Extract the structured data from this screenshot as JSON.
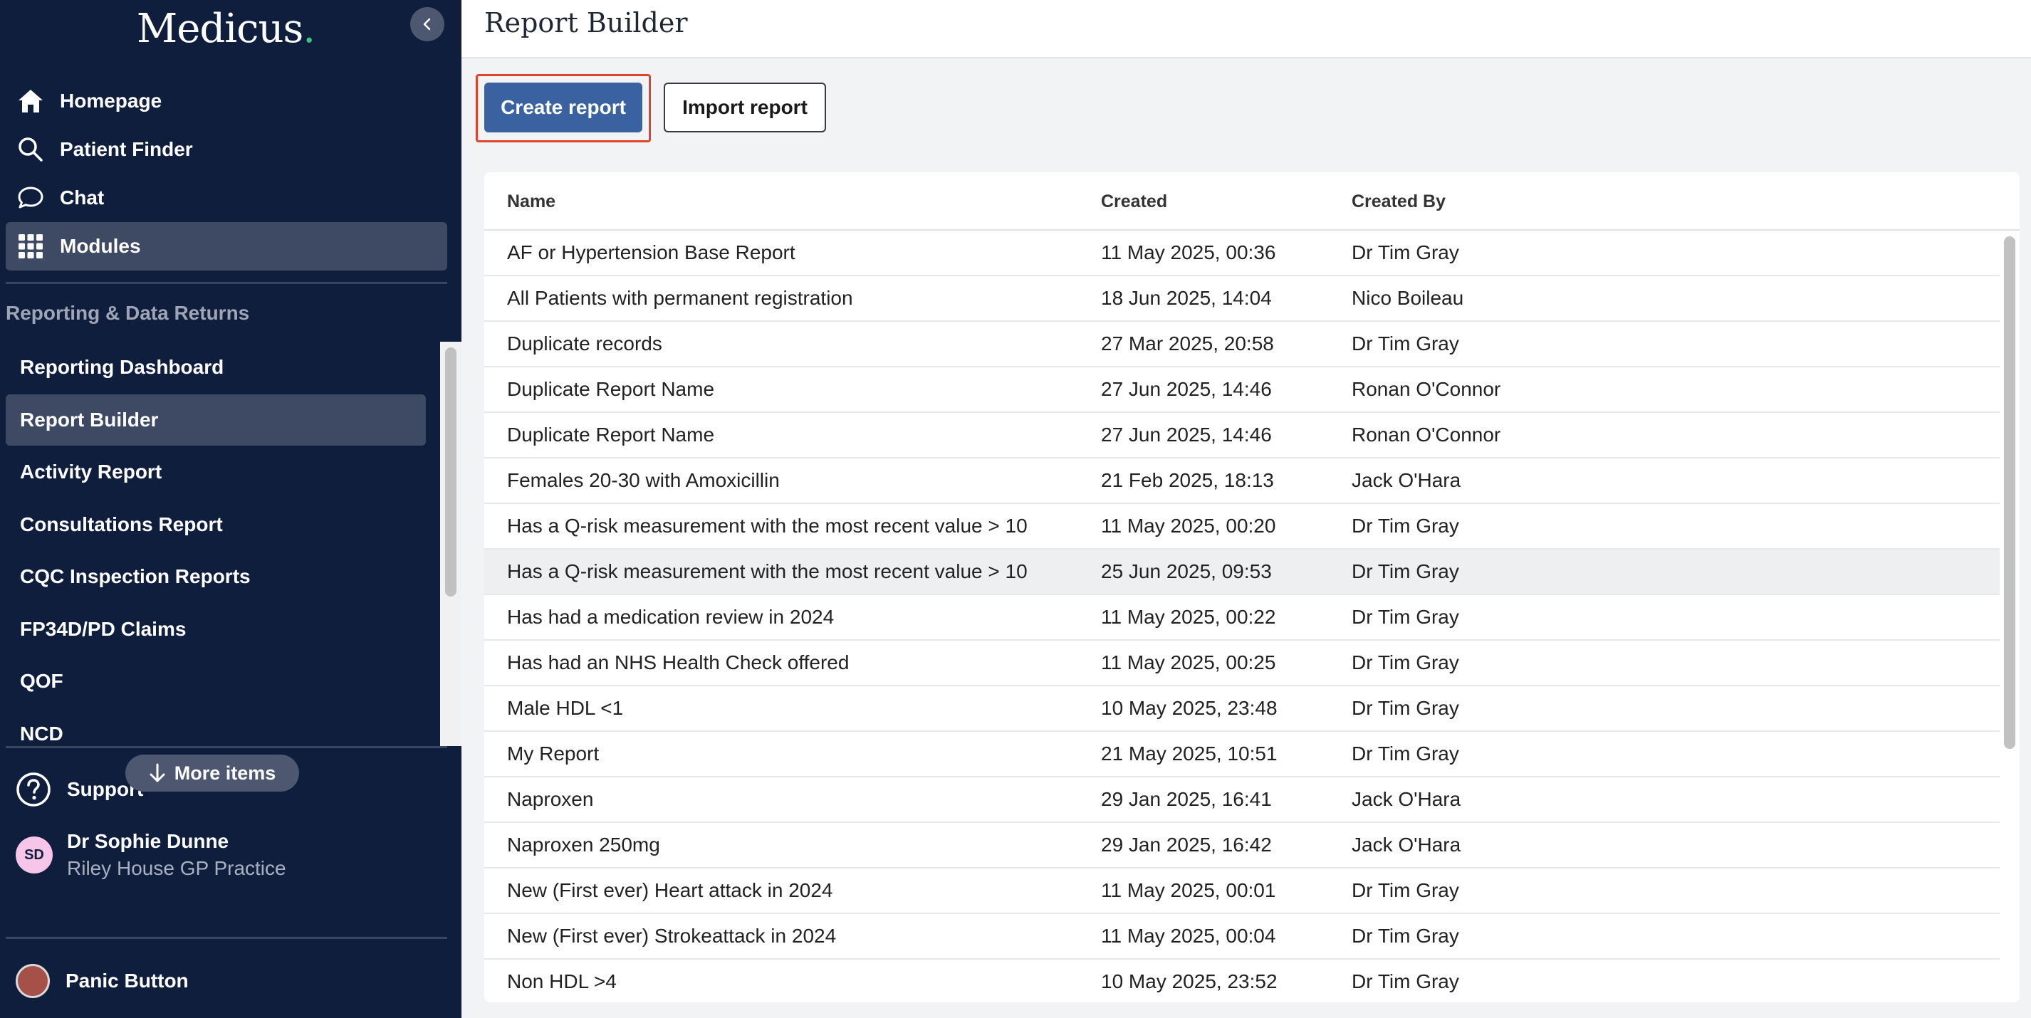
{
  "app": {
    "logo_text": "Medicus",
    "logo_dot": ".",
    "brand_color": "#0f1e3d",
    "accent_color": "#3b62a0"
  },
  "sidebar": {
    "nav": [
      {
        "label": "Homepage",
        "icon": "home-icon"
      },
      {
        "label": "Patient Finder",
        "icon": "search-icon"
      },
      {
        "label": "Chat",
        "icon": "chat-icon"
      },
      {
        "label": "Modules",
        "icon": "grid-icon",
        "active": true
      }
    ],
    "section_title": "Reporting & Data Returns",
    "sub_items": [
      {
        "label": "Reporting Dashboard"
      },
      {
        "label": "Report Builder",
        "active": true
      },
      {
        "label": "Activity Report"
      },
      {
        "label": "Consultations Report"
      },
      {
        "label": "CQC Inspection Reports"
      },
      {
        "label": "FP34D/PD Claims"
      },
      {
        "label": "QOF"
      },
      {
        "label": "NCD"
      }
    ],
    "more_items_label": "More items",
    "support_label": "Support",
    "user": {
      "initials": "SD",
      "name": "Dr Sophie Dunne",
      "practice": "Riley House GP Practice"
    },
    "panic_label": "Panic Button"
  },
  "header": {
    "title": "Report Builder"
  },
  "toolbar": {
    "create_label": "Create report",
    "import_label": "Import report"
  },
  "table": {
    "columns": [
      "Name",
      "Created",
      "Created By"
    ],
    "rows": [
      {
        "name": "AF or Hypertension Base Report",
        "created": "11 May 2025, 00:36",
        "created_by": "Dr Tim Gray"
      },
      {
        "name": "All Patients with permanent registration",
        "created": "18 Jun 2025, 14:04",
        "created_by": "Nico Boileau"
      },
      {
        "name": "Duplicate records",
        "created": "27 Mar 2025, 20:58",
        "created_by": "Dr Tim Gray"
      },
      {
        "name": "Duplicate Report Name",
        "created": "27 Jun 2025, 14:46",
        "created_by": "Ronan O'Connor"
      },
      {
        "name": "Duplicate Report Name",
        "created": "27 Jun 2025, 14:46",
        "created_by": "Ronan O'Connor"
      },
      {
        "name": "Females 20-30 with Amoxicillin",
        "created": "21 Feb 2025, 18:13",
        "created_by": "Jack O'Hara"
      },
      {
        "name": "Has a Q-risk measurement with the most recent value > 10",
        "created": "11 May 2025, 00:20",
        "created_by": "Dr Tim Gray"
      },
      {
        "name": "Has a Q-risk measurement with the most recent value > 10",
        "created": "25 Jun 2025, 09:53",
        "created_by": "Dr Tim Gray",
        "highlighted": true
      },
      {
        "name": "Has had a medication review in 2024",
        "created": "11 May 2025, 00:22",
        "created_by": "Dr Tim Gray"
      },
      {
        "name": "Has had an NHS Health Check offered",
        "created": "11 May 2025, 00:25",
        "created_by": "Dr Tim Gray"
      },
      {
        "name": "Male HDL <1",
        "created": "10 May 2025, 23:48",
        "created_by": "Dr Tim Gray"
      },
      {
        "name": "My Report",
        "created": "21 May 2025, 10:51",
        "created_by": "Dr Tim Gray"
      },
      {
        "name": "Naproxen",
        "created": "29 Jan 2025, 16:41",
        "created_by": "Jack O'Hara"
      },
      {
        "name": "Naproxen 250mg",
        "created": "29 Jan 2025, 16:42",
        "created_by": "Jack O'Hara"
      },
      {
        "name": "New (First ever) Heart attack in 2024",
        "created": "11 May 2025, 00:01",
        "created_by": "Dr Tim Gray"
      },
      {
        "name": "New (First ever) Strokeattack in 2024",
        "created": "11 May 2025, 00:04",
        "created_by": "Dr Tim Gray"
      },
      {
        "name": "Non HDL >4",
        "created": "10 May 2025, 23:52",
        "created_by": "Dr Tim Gray"
      }
    ]
  }
}
